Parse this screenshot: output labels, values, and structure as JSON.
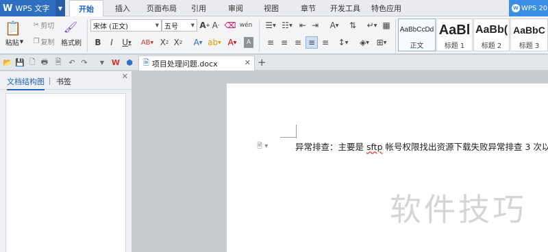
{
  "app": {
    "logo": "W",
    "name": "WPS 文字",
    "account": "WPS 20"
  },
  "menu": {
    "tabs": [
      {
        "label": "开始",
        "active": true
      },
      {
        "label": "插入"
      },
      {
        "label": "页面布局"
      },
      {
        "label": "引用"
      },
      {
        "label": "审阅"
      },
      {
        "label": "视图"
      },
      {
        "label": "章节"
      },
      {
        "label": "开发工具"
      },
      {
        "label": "特色应用"
      }
    ]
  },
  "ribbon": {
    "paste_label": "粘贴",
    "cut_label": "剪切",
    "copy_label": "复制",
    "format_painter_label": "格式刷",
    "font_name": "宋体 (正文)",
    "font_size": "五号",
    "styles": [
      {
        "sample": "AaBbCcDd",
        "name": "正文",
        "selected": true
      },
      {
        "sample": "AaBl",
        "name": "标题 1"
      },
      {
        "sample": "AaBb(",
        "name": "标题 2"
      },
      {
        "sample": "AaBbC",
        "name": "标题 3"
      }
    ]
  },
  "document_tab": {
    "title": "项目处理问题.docx"
  },
  "left_pane": {
    "tab_outline": "文档结构图",
    "tab_bookmarks": "书签"
  },
  "document": {
    "text_before": "异常排查：主要是 ",
    "text_flagged": "sftp",
    "text_after": " 帐号权限找出资源下载失败异常排查 3 次以上",
    "watermark": "软件技巧"
  },
  "colors": {
    "accent": "#2f6fc2",
    "active_tab_text": "#1b62c0",
    "account": "#3a8ee6"
  }
}
